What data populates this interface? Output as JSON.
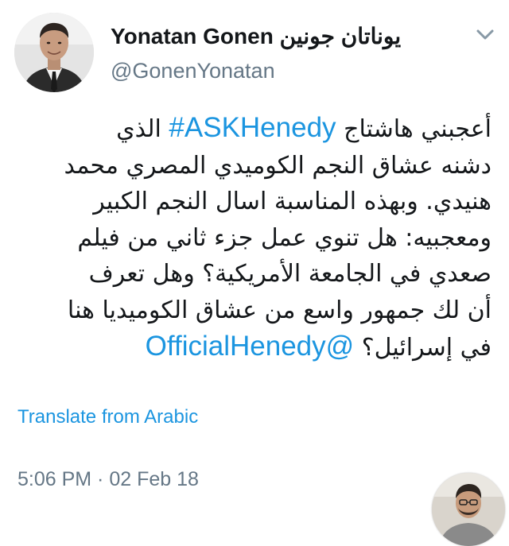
{
  "tweet": {
    "author": {
      "display_name": "Yonatan Gonen يوناتان جونين",
      "handle": "@GonenYonatan"
    },
    "body_lines": [
      [
        "أعجبني هاشتاج ",
        {
          "link": "ASKHenedy#"
        },
        " الذي"
      ],
      [
        "دشنه عشاق النجم الكوميدي المصري محمد"
      ],
      [
        "هنيدي. وبهذه المناسبة اسال النجم الكبير"
      ],
      [
        "ومعجبيه: هل تنوي عمل جزء ثاني من فيلم"
      ],
      [
        "صعدي في الجامعة الأمريكية؟ وهل تعرف"
      ],
      [
        "أن لك جمهور واسع من عشاق الكوميديا هنا"
      ],
      [
        "في إسرائيل؟ ",
        {
          "link": "@OfficialHenedy"
        }
      ]
    ],
    "translate_label": "Translate from Arabic",
    "timestamp": "5:06 PM · 02 Feb 18"
  },
  "icons": {
    "menu": "chevron-down-icon"
  },
  "colors": {
    "link": "#1b95e0",
    "secondary_text": "#657786",
    "primary_text": "#14171a",
    "background": "#ffffff"
  }
}
